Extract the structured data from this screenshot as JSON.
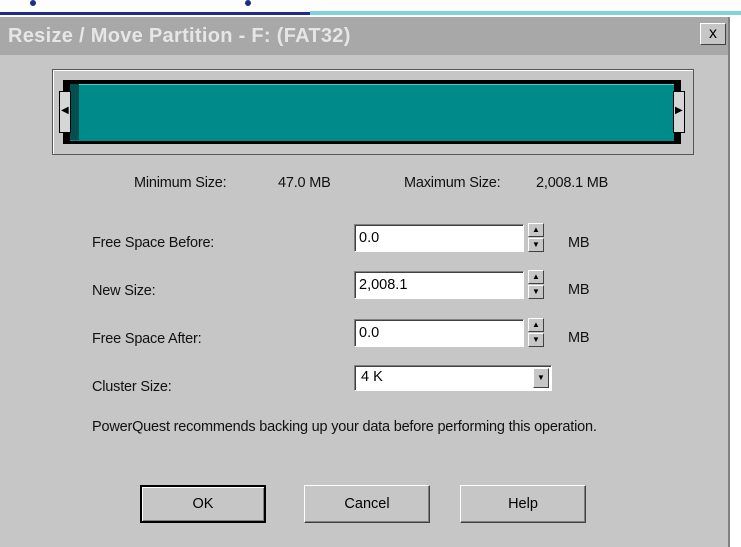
{
  "dialog": {
    "title": "Resize / Move Partition - F:  (FAT32)",
    "close_symbol": "x"
  },
  "gauge": {
    "fill_fraction": 1.0,
    "color": "#008b8b",
    "left_handle_icon": "resize-handle-icon",
    "right_handle_icon": "resize-handle-icon"
  },
  "sizes": {
    "minimum_label": "Minimum Size:",
    "minimum_value": "47.0 MB",
    "maximum_label": "Maximum Size:",
    "maximum_value": "2,008.1 MB"
  },
  "form": {
    "free_before": {
      "label": "Free Space Before:",
      "value": "0.0",
      "unit": "MB"
    },
    "new_size": {
      "label": "New Size:",
      "value": "2,008.1",
      "unit": "MB"
    },
    "free_after": {
      "label": "Free Space After:",
      "value": "0.0",
      "unit": "MB"
    },
    "cluster": {
      "label": "Cluster Size:",
      "value": "4 K"
    }
  },
  "note": "PowerQuest recommends backing up your data before performing this operation.",
  "buttons": {
    "ok": "OK",
    "cancel": "Cancel",
    "help": "Help"
  }
}
